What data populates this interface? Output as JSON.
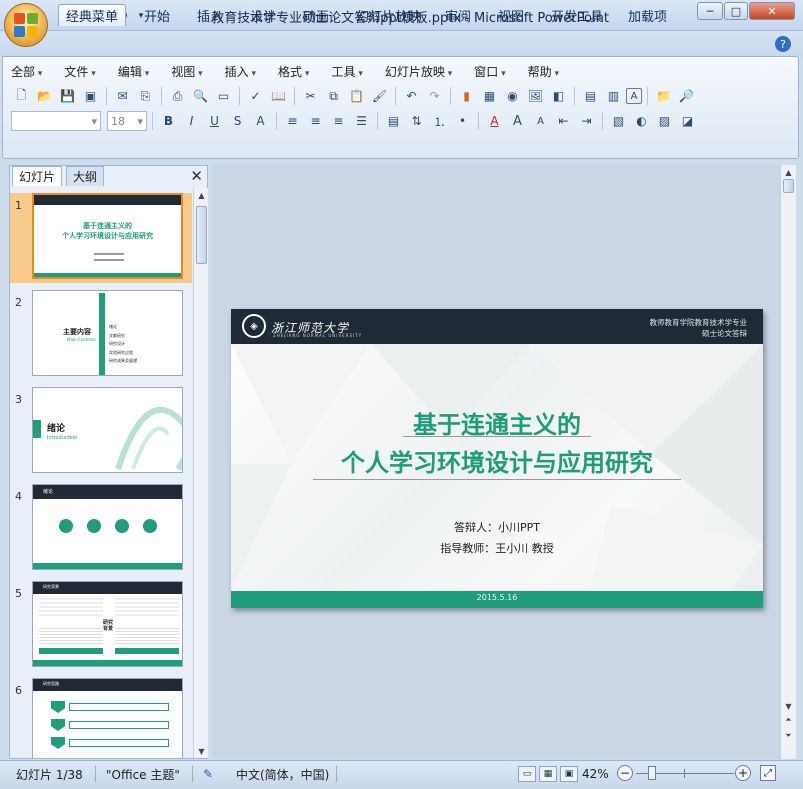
{
  "window": {
    "title": "教育技术学专业硕士论文答辩ppt模板.pptx - Microsoft PowerPoint",
    "minimize": "─",
    "maximize": "□",
    "close": "✕"
  },
  "ribbon_tabs": [
    "经典菜单",
    "开始",
    "插入",
    "设计",
    "动画",
    "幻灯片放映",
    "审阅",
    "视图",
    "开发工具",
    "加载项"
  ],
  "classic_menus": [
    "全部",
    "文件",
    "编辑",
    "视图",
    "插入",
    "格式",
    "工具",
    "幻灯片放映",
    "窗口",
    "帮助"
  ],
  "font_size_value": "18",
  "pane_tabs": {
    "slides": "幻灯片",
    "outline": "大纲",
    "close": "✕"
  },
  "thumbnails": [
    {
      "number": "1",
      "line1": "基于连通主义的",
      "line2": "个人学习环境设计与应用研究"
    },
    {
      "number": "2",
      "title": "主要内容",
      "sub": "Main Contents",
      "items": [
        "绪论",
        "文献研究",
        "研究设计",
        "实验研究过程",
        "研究成果及展望"
      ]
    },
    {
      "number": "3",
      "title": "绪论",
      "sub": "Introduction"
    },
    {
      "number": "4",
      "title": "绪论"
    },
    {
      "number": "5",
      "title": "研究背景",
      "mid": "研究背景"
    },
    {
      "number": "6",
      "title": "研究思路"
    }
  ],
  "slide": {
    "school": "浙江师范大学",
    "school_en": "ZHEJIANG NORMAL UNIVERSITY",
    "header_right_1": "教师教育学院教育技术学专业",
    "header_right_2": "硕士论文答辩",
    "title_line1": "基于连通主义的",
    "title_line2": "个人学习环境设计与应用研究",
    "respondent": "答辩人：小川PPT",
    "advisor": "指导教师：王小川 教授",
    "date": "2015.5.16",
    "accent_color": "#1f9d7c",
    "header_color": "#1e2a36"
  },
  "status": {
    "slide_indicator": "幻灯片 1/38",
    "theme": "\"Office 主题\"",
    "language": "中文(简体，中国)",
    "zoom": "42%"
  }
}
